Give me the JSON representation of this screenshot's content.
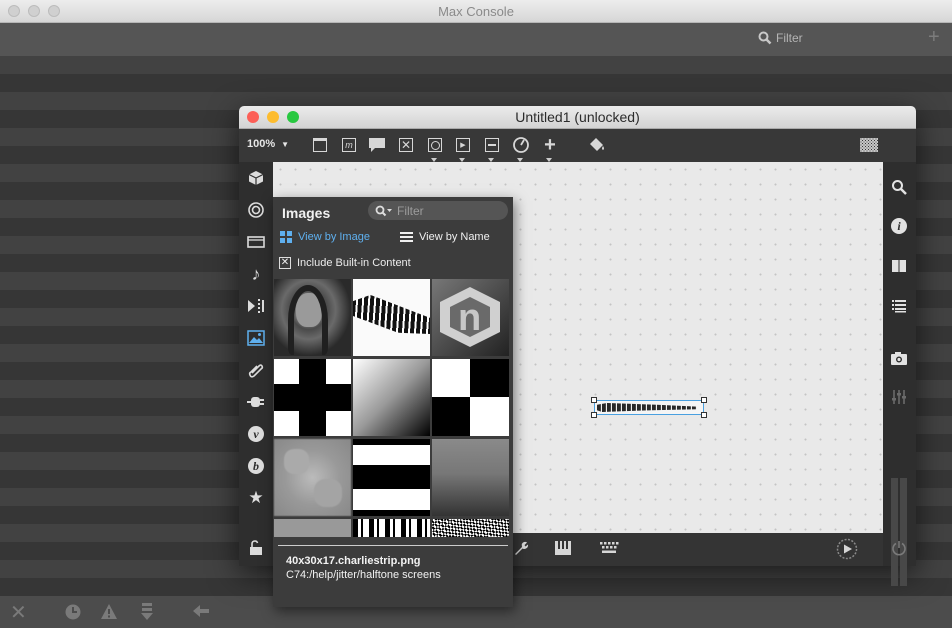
{
  "console": {
    "title": "Max Console",
    "filter_placeholder": "Filter",
    "add_icon": "plus-icon",
    "bottom_icons": [
      "clear-icon",
      "clock-icon",
      "warning-icon",
      "scroll-icon",
      "back-icon"
    ]
  },
  "patcher": {
    "title": "Untitled1 (unlocked)",
    "zoom": "100%",
    "toolbar_icons": [
      "new-object-icon",
      "message-icon",
      "comment-icon",
      "toggle-icon",
      "button-icon",
      "playbar-icon",
      "slider-icon",
      "dial-icon",
      "add-icon",
      "paint-bucket-icon",
      "grid-icon"
    ],
    "left_sidebar_icons": [
      "package-icon",
      "target-icon",
      "media-icon",
      "music-note-icon",
      "playlist-icon",
      "image-icon",
      "paperclip-icon",
      "plug-icon",
      "vizzie-icon",
      "bpatcher-icon",
      "star-icon",
      "lock-icon"
    ],
    "right_sidebar_icons": [
      "search-icon",
      "info-icon",
      "book-icon",
      "list-icon",
      "camera-icon",
      "mixer-icon",
      "level-meter"
    ],
    "bottom_icons": [
      "wrench-icon",
      "piano-icon",
      "keyboard-icon",
      "play-icon",
      "power-icon"
    ]
  },
  "images_panel": {
    "title": "Images",
    "filter_placeholder": "Filter",
    "view_by_image": "View by Image",
    "view_by_name": "View by Name",
    "include_builtin": "Include Built-in Content",
    "include_builtin_checked": true,
    "selected_file": "40x30x17.charliestrip.png",
    "selected_path": "C74:/help/jitter/halftone screens"
  },
  "colors": {
    "accent": "#5fb0ef",
    "close": "#fc5f57",
    "minimize": "#fdbc2e",
    "zoom": "#28c840"
  }
}
